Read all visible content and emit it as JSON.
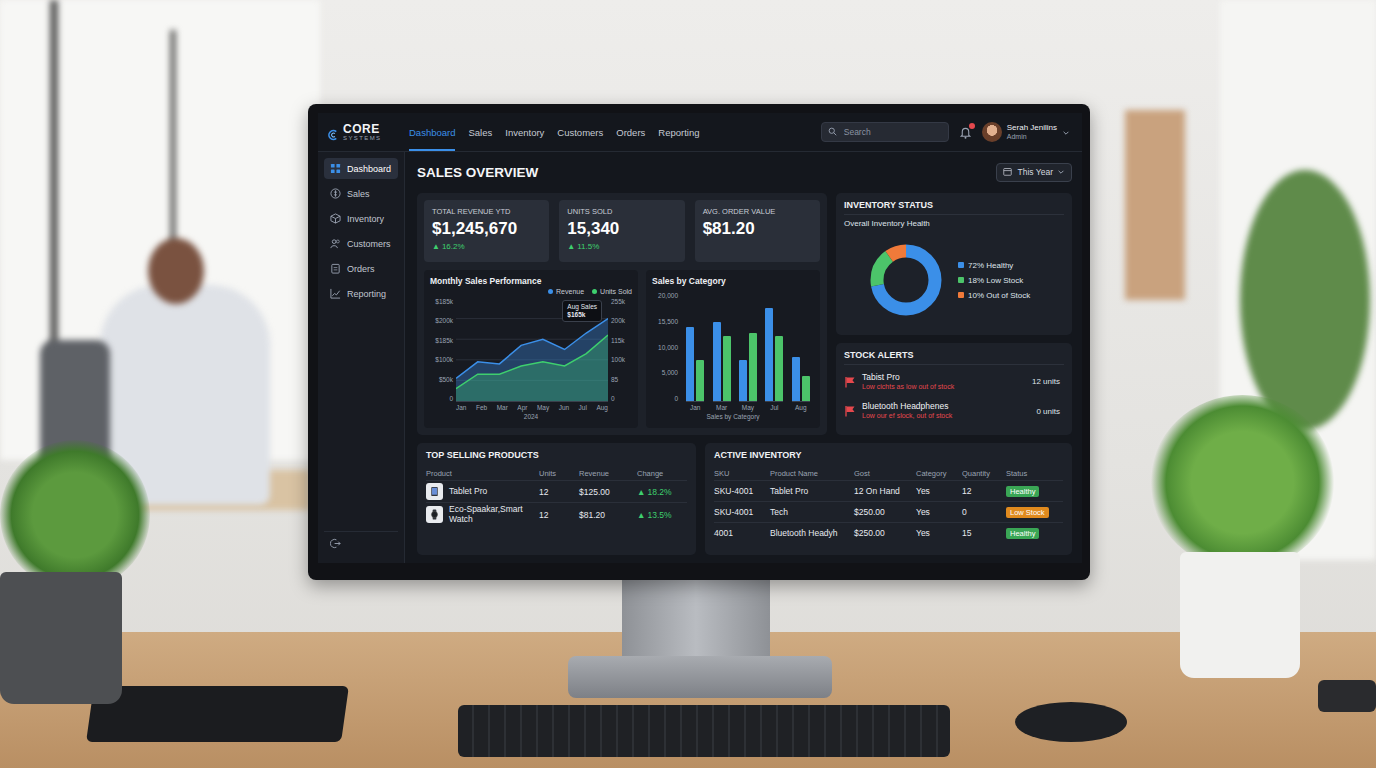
{
  "app": {
    "logo_top": "CORE",
    "logo_bottom": "SYSTEMS"
  },
  "nav": [
    {
      "label": "Dashboard",
      "selected": true
    },
    {
      "label": "Sales",
      "selected": false
    },
    {
      "label": "Inventory",
      "selected": false
    },
    {
      "label": "Customers",
      "selected": false
    },
    {
      "label": "Orders",
      "selected": false
    },
    {
      "label": "Reporting",
      "selected": false
    }
  ],
  "search": {
    "placeholder": "Search"
  },
  "notifications": {
    "unread": true
  },
  "user": {
    "name": "Serah Jenilins",
    "role": "Admin"
  },
  "sidebar": {
    "items": [
      {
        "label": "Dashboard",
        "selected": true
      },
      {
        "label": "Sales",
        "selected": false
      },
      {
        "label": "Inventory",
        "selected": false
      },
      {
        "label": "Customers",
        "selected": false
      },
      {
        "label": "Orders",
        "selected": false
      },
      {
        "label": "Reporting",
        "selected": false
      }
    ]
  },
  "page": {
    "title": "SALES OVERVIEW",
    "period": "This Year"
  },
  "kpis": [
    {
      "label": "TOTAL REVENUE YTD",
      "value": "$1,245,670",
      "arrow": "▲",
      "change": "16.2%"
    },
    {
      "label": "UNITS SOLD",
      "value": "15,340",
      "arrow": "▲",
      "change": "11.5%"
    },
    {
      "label": "AVG. ORDER VALUE",
      "value": "$81.20"
    }
  ],
  "monthly_chart": {
    "title": "Monthly Sales Performance",
    "left_ticks": [
      "$185k",
      "$200k",
      "$185k",
      "$100k",
      "$50k",
      "0"
    ],
    "right_ticks": [
      "255k",
      "200k",
      "115k",
      "100k",
      "85",
      "0"
    ],
    "x_labels": [
      "Jan",
      "Feb",
      "Mar",
      "Apr",
      "May",
      "Jun",
      "Jul",
      "Aug"
    ],
    "year": "2024",
    "tooltip": {
      "title": "Aug Sales",
      "value": "$165k"
    },
    "series": [
      {
        "name": "Revenue",
        "color": "#3b8fe8",
        "values": [
          55,
          95,
          90,
          135,
          150,
          125,
          165,
          200
        ]
      },
      {
        "name": "Units Sold",
        "color": "#3ecf6e",
        "values": [
          30,
          65,
          65,
          85,
          95,
          85,
          115,
          160
        ]
      }
    ]
  },
  "category_chart": {
    "title": "Sales by Category",
    "ticks": [
      "20,000",
      "15,500",
      "10,000",
      "5,000",
      "0"
    ],
    "caption": "Sales by Category",
    "series": [
      {
        "color": "#3b8fe8"
      },
      {
        "color": "#4cc46a"
      }
    ],
    "groups": [
      {
        "label": "Jan",
        "values": [
          13500,
          7500
        ]
      },
      {
        "label": "Mar",
        "values": [
          14500,
          12000
        ]
      },
      {
        "label": "May",
        "values": [
          7500,
          12500
        ]
      },
      {
        "label": "Jul",
        "values": [
          17000,
          12000
        ]
      },
      {
        "label": "Aug",
        "values": [
          8000,
          4500
        ]
      }
    ]
  },
  "inventory_status": {
    "title": "INVENTORY STATUS",
    "subtitle": "Overall Inventory Health",
    "segments": [
      {
        "label": "72% Healthy",
        "level": 0.72,
        "color": "#3b8fe8"
      },
      {
        "label": "18% Low Stock",
        "level": 0.18,
        "color": "#4cc46a"
      },
      {
        "label": "10% Out of Stock",
        "level": 0.1,
        "color": "#f07a3a"
      }
    ]
  },
  "stock_alerts": {
    "title": "STOCK ALERTS",
    "items": [
      {
        "name": "Tabist Pro",
        "note": "Low cichts as low out of stock",
        "quantity": "12 units"
      },
      {
        "name": "Bluetooth Headphenes",
        "note": "Low our ef slock, out of stock",
        "quantity": "0 units"
      }
    ]
  },
  "top_products": {
    "title": "TOP SELLING PRODUCTS",
    "columns": [
      "Product",
      "Units",
      "Revenue",
      "Change"
    ],
    "rows": [
      {
        "product": "Tablet Pro",
        "units": "12",
        "revenue": "$125.00",
        "arrow": "▲",
        "change": "18.2%"
      },
      {
        "product": "Eco-Spaakar,Smart Watch",
        "units": "12",
        "revenue": "$81.20",
        "arrow": "▲",
        "change": "13.5%"
      }
    ]
  },
  "active_inventory": {
    "title": "ACTIVE INVENTORY",
    "columns": [
      "SKU",
      "Product Name",
      "Gost",
      "Category",
      "Quantity",
      "Status"
    ],
    "rows": [
      {
        "cells": [
          "SKU-4001",
          "Tablet Pro",
          "12 On Hand",
          "Yes",
          "12"
        ],
        "status": "Healthy",
        "color": "#3aa655"
      },
      {
        "cells": [
          "SKU-4001",
          "Tech",
          "$250.00",
          "Yes",
          "0"
        ],
        "status": "Low Stock",
        "color": "#e08a1e"
      },
      {
        "cells": [
          "4001",
          "Bluetooth Headyh",
          "$250.00",
          "Yes",
          "15"
        ],
        "status": "Healthy",
        "color": "#3aa655"
      }
    ]
  }
}
